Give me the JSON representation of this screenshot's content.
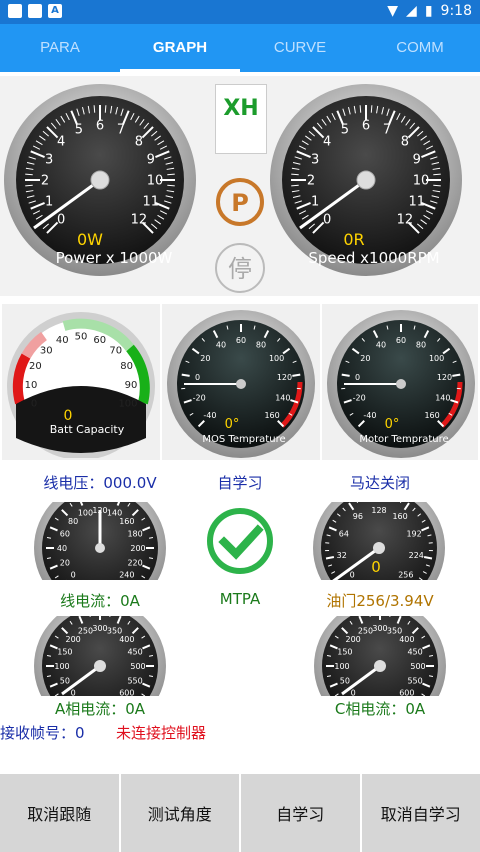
{
  "status": {
    "time": "9:18"
  },
  "tabs": [
    {
      "label": "PARA",
      "active": false
    },
    {
      "label": "GRAPH",
      "active": true
    },
    {
      "label": "CURVE",
      "active": false
    },
    {
      "label": "COMM",
      "active": false
    }
  ],
  "big_gauges": {
    "power": {
      "value_text": "0W",
      "unit_text": "Power x 1000W",
      "ticks": [
        "0",
        "1",
        "2",
        "3",
        "4",
        "5",
        "6",
        "7",
        "8",
        "9",
        "10",
        "11",
        "12"
      ]
    },
    "speed": {
      "value_text": "0R",
      "unit_text": "Speed x1000RPM",
      "ticks": [
        "0",
        "1",
        "2",
        "3",
        "4",
        "5",
        "6",
        "7",
        "8",
        "9",
        "10",
        "11",
        "12"
      ]
    }
  },
  "center_icons": {
    "xh_label": "XH",
    "park_label": "P",
    "stop_label": "停"
  },
  "mid_gauges": {
    "batt": {
      "value_text": "0",
      "label": "Batt Capacity",
      "ticks": [
        "0",
        "10",
        "20",
        "30",
        "40",
        "50",
        "60",
        "70",
        "80",
        "90",
        "100"
      ]
    },
    "mos": {
      "value_text": "0°",
      "label": "MOS Temprature",
      "ticks": [
        "-40",
        "-20",
        "0",
        "20",
        "40",
        "60",
        "80",
        "100",
        "120",
        "140",
        "160"
      ]
    },
    "motor": {
      "value_text": "0°",
      "label": "Motor Temprature",
      "ticks": [
        "-40",
        "-20",
        "0",
        "20",
        "40",
        "60",
        "80",
        "100",
        "120",
        "140",
        "160"
      ]
    }
  },
  "row1_labels": {
    "line_voltage": "线电压：000.0V",
    "self_learn": "自学习",
    "motor_state": "马达关闭"
  },
  "small_gauges": {
    "line_current": {
      "ticks": [
        "0",
        "20",
        "40",
        "60",
        "80",
        "100",
        "120",
        "140",
        "160",
        "180",
        "200",
        "220",
        "240"
      ]
    },
    "throttle": {
      "value_text": "0",
      "ticks": [
        "0",
        "32",
        "64",
        "96",
        "128",
        "160",
        "192",
        "224",
        "256"
      ]
    }
  },
  "row2_labels": {
    "line_current": "线电流：0A",
    "mtpa": "MTPA",
    "throttle": "油门256/3.94V"
  },
  "phase_gauges": {
    "a_phase": {
      "ticks": [
        "0",
        "50",
        "100",
        "150",
        "200",
        "250",
        "300",
        "350",
        "400",
        "450",
        "500",
        "550",
        "600"
      ]
    },
    "c_phase": {
      "ticks": [
        "0",
        "50",
        "100",
        "150",
        "200",
        "250",
        "300",
        "350",
        "400",
        "450",
        "500",
        "550",
        "600"
      ]
    }
  },
  "row3_labels": {
    "a_phase": "A相电流：0A",
    "c_phase": "C相电流：0A"
  },
  "footer_info": {
    "frame_label": "接收帧号：0",
    "connection_status": "未连接控制器"
  },
  "buttons": [
    "取消跟随",
    "测试角度",
    "自学习",
    "取消自学习"
  ],
  "colors": {
    "tab_bg": "#2196f3",
    "status_bg": "#1976d2",
    "value_yellow": "#ffd400",
    "check_green": "#2db34a"
  }
}
